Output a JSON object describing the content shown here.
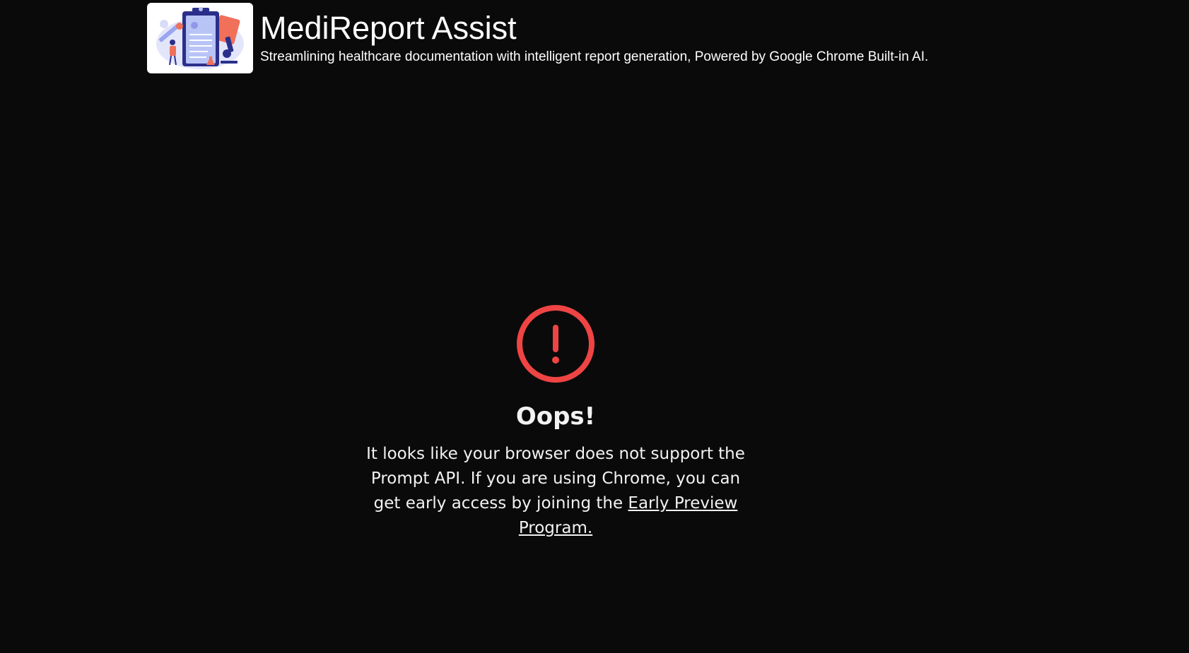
{
  "header": {
    "title": "MediReport Assist",
    "subtitle": "Streamlining healthcare documentation with intelligent report generation, Powered by Google Chrome Built-in AI.",
    "logo_icon": "clipboard-medical-illustration"
  },
  "error": {
    "icon": "alert-circle-icon",
    "icon_color": "#ef4444",
    "heading": "Oops!",
    "message": "It looks like your browser does not support the Prompt API. If you are using Chrome, you can get early access by joining the",
    "link_label": "Early Preview Program."
  },
  "colors": {
    "background": "#0a0a0a",
    "text": "#ffffff",
    "accent": "#ef4444"
  }
}
